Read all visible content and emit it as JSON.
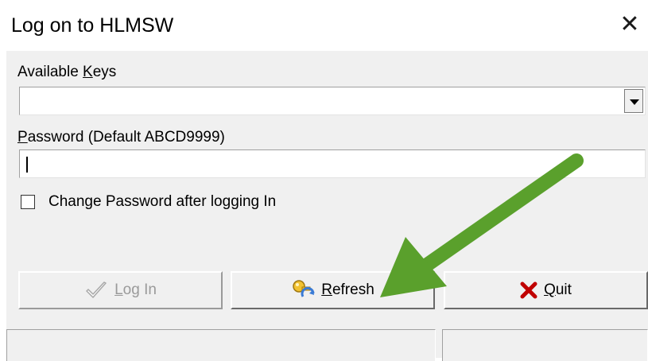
{
  "window": {
    "title": "Log on to HLMSW",
    "close_label": "✕"
  },
  "keys": {
    "label_pre": "Available ",
    "label_accel": "K",
    "label_post": "eys",
    "selected": ""
  },
  "password": {
    "label_accel": "P",
    "label_rest": "assword (Default  ABCD9999)",
    "value": ""
  },
  "change_password": {
    "label": "Change Password after logging In",
    "checked": false
  },
  "buttons": {
    "login": {
      "accel": "L",
      "rest": "og In",
      "enabled": false
    },
    "refresh": {
      "accel": "R",
      "rest": "efresh"
    },
    "quit": {
      "accel": "Q",
      "rest": "uit"
    }
  },
  "colors": {
    "annotation_arrow": "#5aa02c",
    "quit_icon": "#c00000",
    "key_icon": "#e8b82a"
  }
}
